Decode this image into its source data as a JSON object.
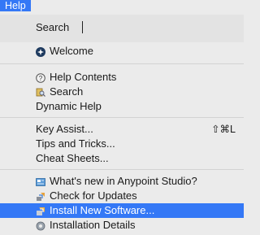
{
  "menubar": {
    "active_menu": "Help"
  },
  "menu": {
    "search_label": "Search",
    "search_value": "",
    "items": {
      "welcome": "Welcome",
      "help_contents": "Help Contents",
      "search": "Search",
      "dynamic_help": "Dynamic Help",
      "key_assist": "Key Assist...",
      "key_assist_shortcut": "⇧⌘L",
      "tips_and_tricks": "Tips and Tricks...",
      "cheat_sheets": "Cheat Sheets...",
      "whats_new": "What's new in Anypoint Studio?",
      "check_updates": "Check for Updates",
      "install_new_software": "Install New Software...",
      "installation_details": "Installation Details"
    },
    "highlighted_item": "install_new_software"
  },
  "colors": {
    "highlight": "#3478f6",
    "menu_bg": "#ebebeb"
  },
  "icons": {
    "welcome": "gear-badge-icon",
    "help_contents": "question-circle-icon",
    "search": "search-help-icon",
    "whats_new": "news-icon",
    "check_updates": "update-arrows-icon",
    "install_new_software": "install-software-icon",
    "installation_details": "gear-details-icon"
  }
}
